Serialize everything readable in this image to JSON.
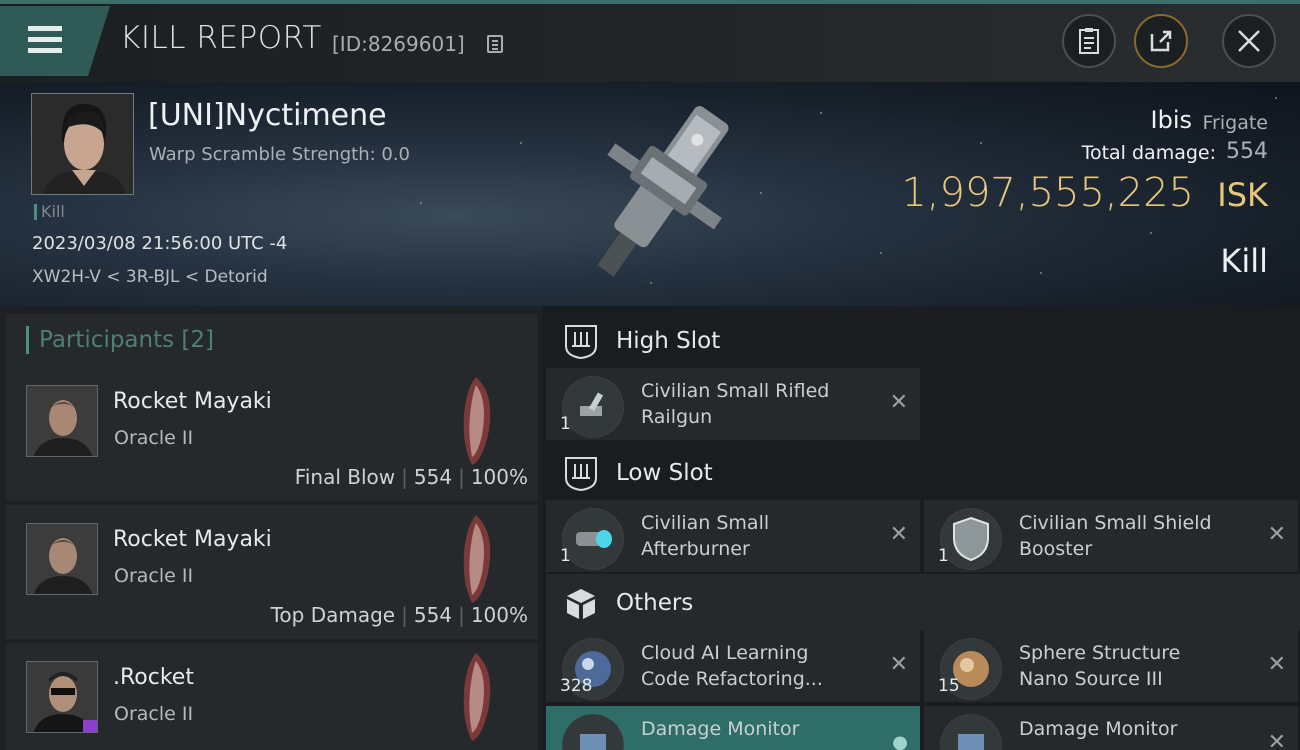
{
  "header": {
    "title": "KILL REPORT",
    "kill_id": "[ID:8269601]"
  },
  "victim": {
    "name": "[UNI]Nyctimene",
    "warp_scramble": "Warp Scramble Strength: 0.0",
    "tag": "Kill",
    "timestamp": "2023/03/08 21:56:00 UTC -4",
    "location": "XW2H-V < 3R-BJL < Detorid",
    "ship_name": "Ibis",
    "ship_class": "Frigate",
    "total_damage_label": "Total damage:",
    "total_damage": "554",
    "isk_value": "1,997,555,225",
    "isk_unit": "ISK",
    "result": "Kill"
  },
  "participants": {
    "header": "Participants [2]",
    "items": [
      {
        "name": "Rocket Mayaki",
        "ship": "Oracle II",
        "role": "Final Blow",
        "damage": "554",
        "percent": "100%"
      },
      {
        "name": "Rocket Mayaki",
        "ship": "Oracle II",
        "role": "Top Damage",
        "damage": "554",
        "percent": "100%"
      },
      {
        "name": ".Rocket",
        "ship": "Oracle II"
      }
    ]
  },
  "modules": {
    "high_slot_title": "High Slot",
    "low_slot_title": "Low Slot",
    "others_title": "Others",
    "high": [
      {
        "name_line1": "Civilian Small Rifled",
        "name_line2": "Railgun",
        "qty": "1"
      }
    ],
    "low": [
      {
        "name_line1": "Civilian Small",
        "name_line2": "Afterburner",
        "qty": "1"
      },
      {
        "name_line1": "Civilian Small Shield",
        "name_line2": "Booster",
        "qty": "1"
      }
    ],
    "others": [
      {
        "name_line1": "Cloud AI Learning",
        "name_line2": "Code Refactoring...",
        "qty": "328"
      },
      {
        "name_line1": "Sphere Structure",
        "name_line2": "Nano Source III",
        "qty": "15"
      },
      {
        "name_line1": "Damage Monitor",
        "name_line2": ""
      },
      {
        "name_line1": "Damage Monitor",
        "name_line2": ""
      }
    ]
  },
  "colors": {
    "accent_teal": "#2e6d68",
    "isk_gold": "#e7c77c"
  }
}
